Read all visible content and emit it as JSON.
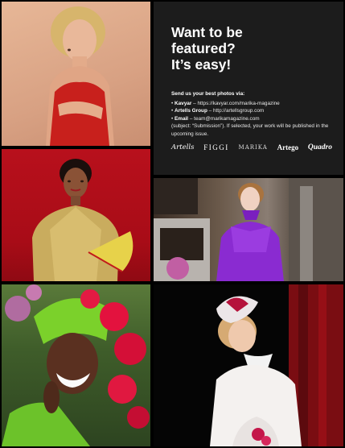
{
  "panel": {
    "headline": [
      "Want to be",
      "featured?",
      "It’s easy!"
    ],
    "lead": "Send us your best photos via:",
    "items": [
      {
        "label": "Kavyar",
        "text": " – https://kavyar.com/marika-magazine"
      },
      {
        "label": "Artells Group",
        "text": " – http://artellsgroup.com"
      },
      {
        "label": "Email",
        "text": " – team@marikamagazine.com"
      }
    ],
    "note": "(subject: “Submission”). If selected, your work will be published in the upcoming issue.",
    "logos": [
      "Artells",
      "FIGGI",
      "MARIKA",
      "Artego",
      "Quadro"
    ]
  },
  "photos": [
    {
      "name": "photo-woman-red-dress"
    },
    {
      "name": "photo-woman-gold-blouse-fan"
    },
    {
      "name": "photo-woman-purple-dress-interior"
    },
    {
      "name": "photo-woman-green-headwrap-flowers"
    },
    {
      "name": "photo-woman-white-hat"
    }
  ],
  "colors": {
    "background": "#000000",
    "panel": "#1c1c1c",
    "text": "#ffffff"
  }
}
